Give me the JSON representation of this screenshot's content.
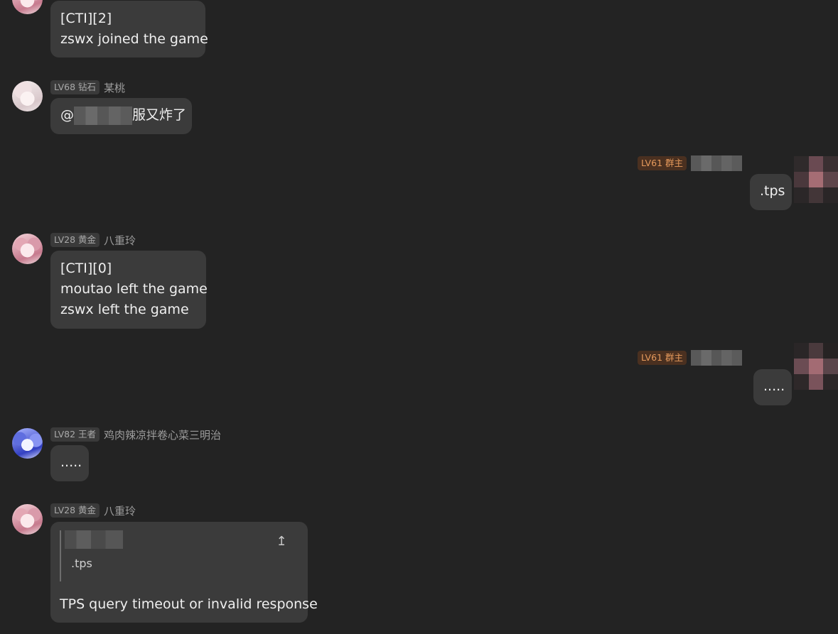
{
  "messages": [
    {
      "lines": [
        "[CTI][2]",
        "zswx joined the game"
      ]
    },
    {
      "level": "LV68 钻石",
      "name": "某桃",
      "text_prefix": "@",
      "text_suffix": "服又炸了"
    },
    {
      "level": "LV61 群主",
      "text": ".tps"
    },
    {
      "level": "LV28 黄金",
      "name": "八重玲",
      "lines": [
        "[CTI][0]",
        "moutao left the game",
        "zswx left the game"
      ]
    },
    {
      "level": "LV61 群主",
      "text": "....."
    },
    {
      "level": "LV82 王者",
      "name": "鸡肉辣凉拌卷心菜三明治",
      "text": "....."
    },
    {
      "level": "LV28 黄金",
      "name": "八重玲",
      "quote_text": ".tps",
      "quote_icon": "↥",
      "text": "TPS query timeout or invalid response"
    }
  ],
  "colors": {
    "background": "#232323",
    "bubble": "#3b3b3b",
    "owner_badge": "#e69a5c"
  }
}
